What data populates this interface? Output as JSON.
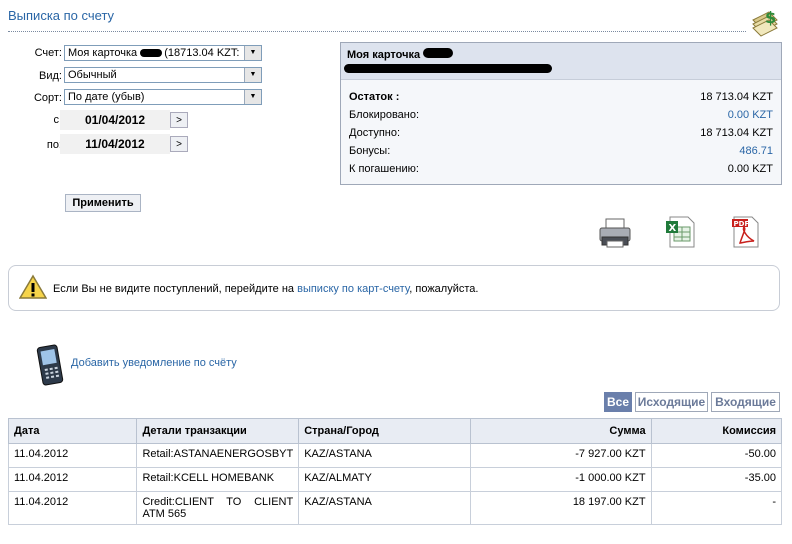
{
  "header": {
    "title": "Выписка по счету",
    "icon": "money-statement-icon"
  },
  "filters": {
    "account_label": "Счет:",
    "account_value": "Моя карточка ",
    "account_suffix": "(18713.04 KZT:",
    "view_label": "Вид:",
    "view_value": "Обычный",
    "sort_label": "Сорт:",
    "sort_value": "По дате (убыв)",
    "from_label": "с:",
    "from_value": "01/04/2012",
    "to_label": "по:",
    "to_value": "11/04/2012",
    "date_btn": ">",
    "apply_label": "Применить"
  },
  "card": {
    "name": "Моя карточка",
    "rows": [
      {
        "label": "Остаток :",
        "value": "18 713.04 KZT",
        "bold": true,
        "color": "#000000"
      },
      {
        "label": "Блокировано:",
        "value": "0.00 KZT",
        "bold": false,
        "color": "#2a66a6"
      },
      {
        "label": "Доступно:",
        "value": "18 713.04 KZT",
        "bold": false,
        "color": "#000000"
      },
      {
        "label": "Бонусы:",
        "value": "486.71",
        "bold": false,
        "color": "#2a66a6"
      },
      {
        "label": "К погашению:",
        "value": "0.00 KZT",
        "bold": false,
        "color": "#000000"
      }
    ]
  },
  "export_icons": [
    "printer-icon",
    "excel-icon",
    "pdf-icon"
  ],
  "notice": {
    "pre": "Если Вы не видите поступлений, перейдите на ",
    "link": "выписку по карт-счету",
    "post": ", пожалуйста."
  },
  "notify_link": "Добавить уведомление по счёту",
  "tabs": {
    "all": "Все",
    "outgoing": "Исходящие",
    "incoming": "Входящие"
  },
  "table": {
    "headers": [
      "Дата",
      "Детали транзакции",
      "Страна/Город",
      "Сумма",
      "Комиссия"
    ],
    "rows": [
      [
        "11.04.2012",
        "Retail:ASTANAENERGOSBYT",
        "KAZ/ASTANA",
        "-7 927.00 KZT",
        "-50.00"
      ],
      [
        "11.04.2012",
        "Retail:KCELL HOMEBANK",
        "KAZ/ALMATY",
        "-1 000.00 KZT",
        "-35.00"
      ],
      [
        "11.04.2012",
        "Credit:CLIENT   TO   CLIENT ATM 565",
        "KAZ/ASTANA",
        "18 197.00 KZT",
        "-"
      ]
    ]
  },
  "colors": {
    "accent": "#2a66a6",
    "tab_active": "#6a7fab",
    "header_bg": "#dde3ee"
  }
}
